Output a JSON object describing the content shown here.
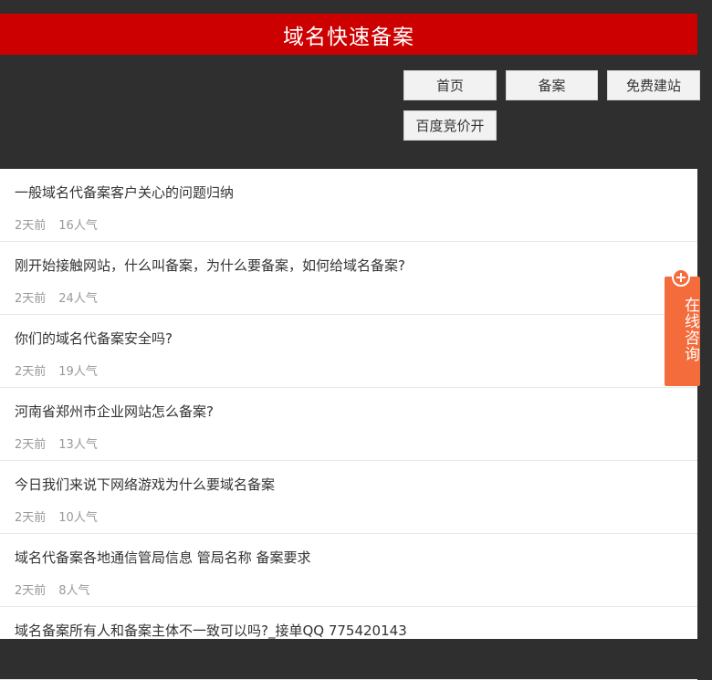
{
  "header": {
    "title": "域名快速备案"
  },
  "nav": {
    "home": "首页",
    "beian": "备案",
    "free_site": "免费建站",
    "baidu_bid": "百度竞价开"
  },
  "articles": [
    {
      "title": "一般域名代备案客户关心的问题归纳",
      "time": "2天前",
      "views": "16人气"
    },
    {
      "title": "刚开始接触网站，什么叫备案，为什么要备案，如何给域名备案?",
      "time": "2天前",
      "views": "24人气"
    },
    {
      "title": "你们的域名代备案安全吗?",
      "time": "2天前",
      "views": "19人气"
    },
    {
      "title": "河南省郑州市企业网站怎么备案?",
      "time": "2天前",
      "views": "13人气"
    },
    {
      "title": "今日我们来说下网络游戏为什么要域名备案",
      "time": "2天前",
      "views": "10人气"
    },
    {
      "title": "域名代备案各地通信管局信息 管局名称 备案要求",
      "time": "2天前",
      "views": "8人气"
    },
    {
      "title": "域名备案所有人和备案主体不一致可以吗?_接单QQ 775420143",
      "time": "",
      "views": ""
    }
  ],
  "consult": {
    "label": "在线咨询",
    "icon": "plus-circle-icon",
    "color": "#f46b3c"
  },
  "colors": {
    "header": "#cc0000",
    "background": "#2f2f2f"
  }
}
